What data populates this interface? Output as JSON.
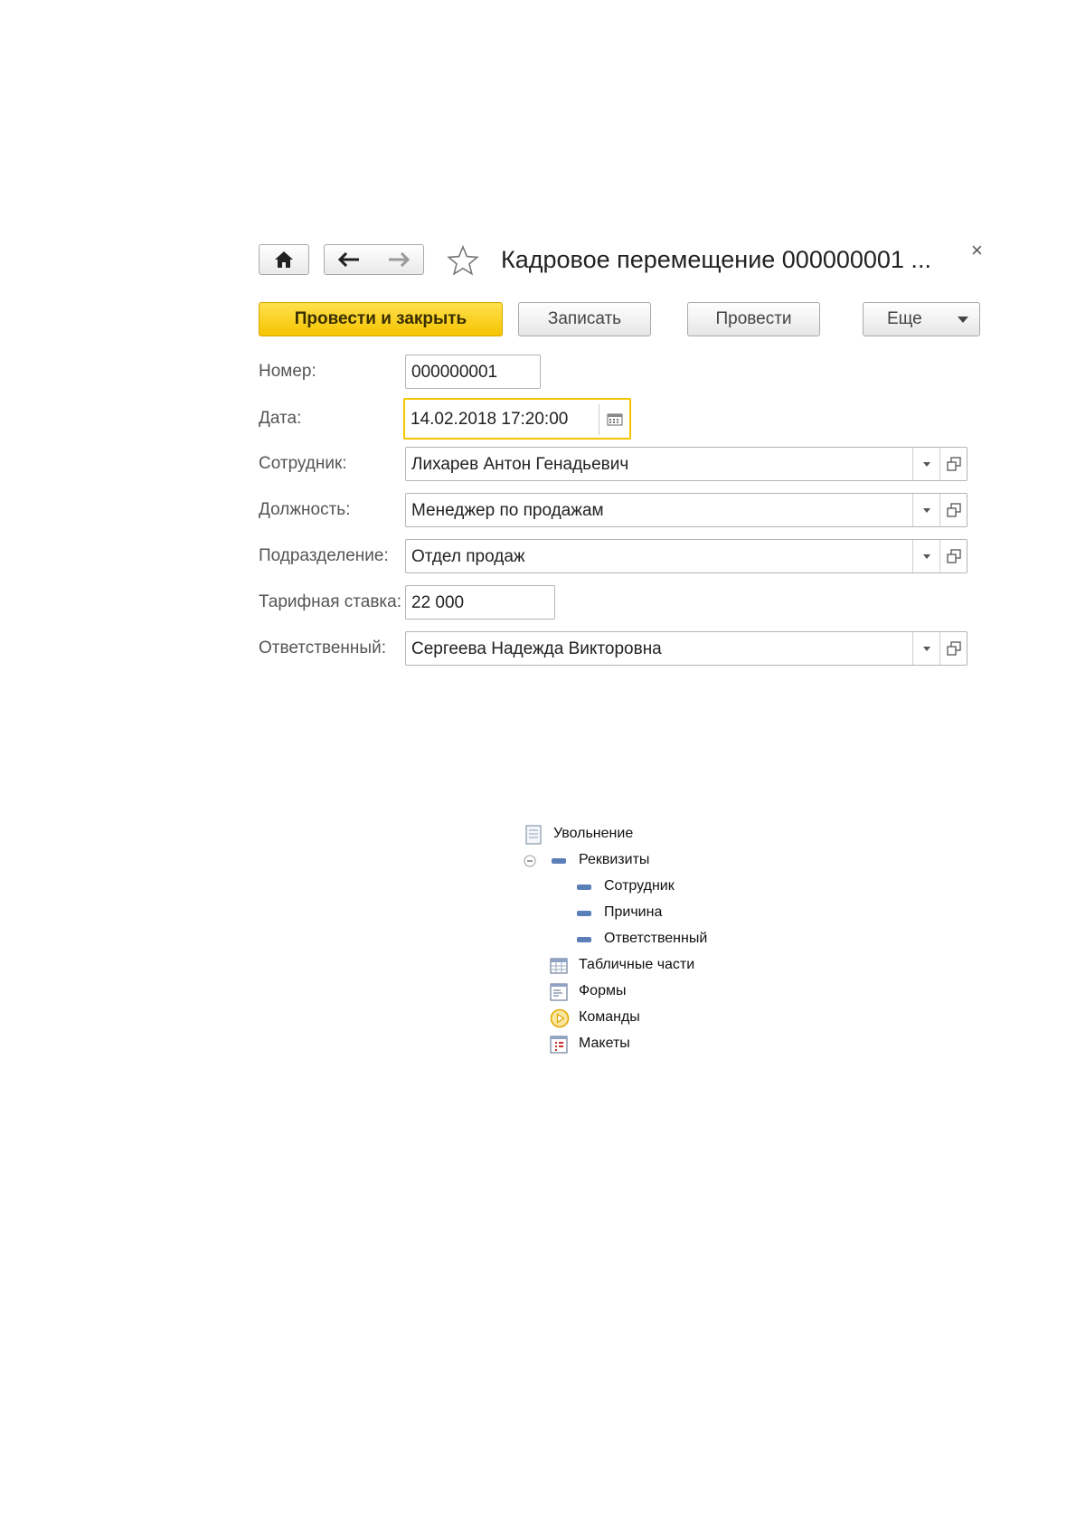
{
  "window": {
    "title": "Кадровое перемещение 000000001 ...",
    "close_label": "×"
  },
  "toolbar": {
    "post_and_close": "Провести и закрыть",
    "save": "Записать",
    "post": "Провести",
    "more": "Еще"
  },
  "fields": {
    "number": {
      "label": "Номер:",
      "value": "000000001"
    },
    "date": {
      "label": "Дата:",
      "value": "14.02.2018 17:20:00"
    },
    "employee": {
      "label": "Сотрудник:",
      "value": "Лихарев Антон Генадьевич"
    },
    "position": {
      "label": "Должность:",
      "value": "Менеджер по продажам"
    },
    "department": {
      "label": "Подразделение:",
      "value": "Отдел продаж"
    },
    "rate": {
      "label": "Тарифная ставка:",
      "value": "22 000"
    },
    "responsible": {
      "label": "Ответственный:",
      "value": "Сергеева Надежда Викторовна"
    }
  },
  "colors": {
    "primary_button": "#f5c400",
    "focus_border": "#f5c400",
    "attribute_icon": "#5b7fb8"
  },
  "tree": {
    "root": "Увольнение",
    "attributes": "Реквизиты",
    "attribute_items": [
      "Сотрудник",
      "Причина",
      "Ответственный"
    ],
    "tabular_sections": "Табличные части",
    "forms": "Формы",
    "commands": "Команды",
    "templates": "Макеты"
  }
}
